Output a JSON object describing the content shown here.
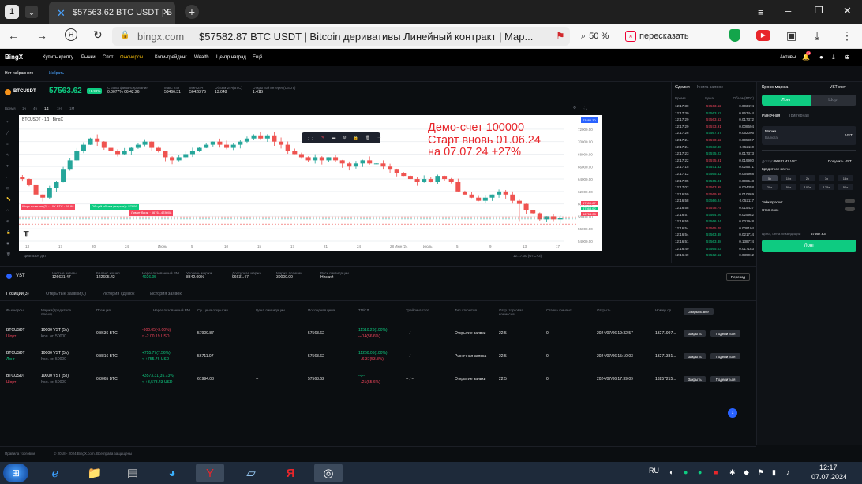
{
  "browser": {
    "tab_title": "$57563.62 BTC USDT | Б",
    "domain": "bingx.com",
    "page_title": "$57582.87 BTC USDT | Bitcoin деривативы Линейный контракт | Мар...",
    "zoom": "50 %",
    "retell": "пересказать"
  },
  "site": {
    "logo": "BingX",
    "nav": [
      "Купить крипту",
      "Рынки",
      "Спот",
      "Фьючерсы",
      "Копи-трейдинг",
      "Wealth",
      "Центр наград",
      "Ещё"
    ],
    "assets_label": "Активы",
    "notif_count": "24",
    "crumb_1": "Нет избранного",
    "crumb_2": "Избрать"
  },
  "ticker": {
    "symbol": "BTCUSDT",
    "leverage_badge": "+1.99%",
    "price": "57563.62",
    "stats": [
      {
        "label": "Ставка финансирования",
        "value": "0.0077% 06:42:26"
      },
      {
        "label": "Макс 24ч",
        "value": "58466.31"
      },
      {
        "label": "Мин 24ч",
        "value": "56428.76"
      },
      {
        "label": "Объем 24ч(BTC)",
        "value": "13.048"
      },
      {
        "label": "Открытый интерес(USDT)",
        "value": "1.41B"
      }
    ]
  },
  "chart": {
    "header": "BTCUSDT · 1Д · BingX",
    "annotation_lines": [
      "Демо-счет 100000",
      "Старт вновь 01.06.24",
      "на 07.07.24 +27%"
    ],
    "price_badges": [
      "57909.87",
      "57563.62",
      "56764.08"
    ],
    "top_badge": "73486.30",
    "y_ticks": [
      "72000.00",
      "70000.00",
      "68000.00",
      "66000.00",
      "64000.00",
      "62000.00",
      "60000.00",
      "58000.00",
      "56000.00",
      "54000.00"
    ],
    "x_ticks": [
      "13",
      "17",
      "20",
      "24",
      "Июнь",
      "5",
      "10",
      "15",
      "17",
      "21",
      "24",
      "28 Июн '24",
      "Июль",
      "5",
      "9",
      "13",
      "17"
    ],
    "position_label_1": "Шорт позиция (3) · 10K BTC · 59.98",
    "position_label_2": "Общий объем (маркет) · 57909",
    "position_label_3": "Лимит бирж · 56761.478008",
    "bottom_left": "Диапазон дат",
    "bottom_right": "12:17:30 (UTC+3)",
    "toolbar_intervals": [
      "Время",
      "1ч",
      "4ч",
      "1Д",
      "1Н",
      "1М"
    ]
  },
  "trades": {
    "tabs": [
      "Сделки",
      "Книга заявок"
    ],
    "headers": [
      "Время",
      "Цена",
      "Объем(BTC)"
    ],
    "rows": [
      {
        "t": "12:17:30",
        "p": "57563.62",
        "v": "0.003474",
        "c": "red"
      },
      {
        "t": "12:17:30",
        "p": "57563.62",
        "v": "0.867444",
        "c": "green"
      },
      {
        "t": "12:17:29",
        "p": "57563.62",
        "v": "0.017372",
        "c": "red"
      },
      {
        "t": "12:17:29",
        "p": "57573.91",
        "v": "0.008694",
        "c": "red"
      },
      {
        "t": "12:17:26",
        "p": "57567.87",
        "v": "0.052096",
        "c": "green"
      },
      {
        "t": "12:17:24",
        "p": "57570.62",
        "v": "0.005957",
        "c": "red"
      },
      {
        "t": "12:17:24",
        "p": "57572.88",
        "v": "0.052110",
        "c": "green"
      },
      {
        "t": "12:17:23",
        "p": "57575.23",
        "v": "0.017373",
        "c": "green"
      },
      {
        "t": "12:17:22",
        "p": "57575.91",
        "v": "0.019980",
        "c": "red"
      },
      {
        "t": "12:17:15",
        "p": "57571.52",
        "v": "0.025571",
        "c": "green"
      },
      {
        "t": "12:17:12",
        "p": "57565.62",
        "v": "0.064968",
        "c": "green"
      },
      {
        "t": "12:17:05",
        "p": "57565.01",
        "v": "0.008543",
        "c": "green"
      },
      {
        "t": "12:17:02",
        "p": "57563.98",
        "v": "0.004358",
        "c": "red"
      },
      {
        "t": "12:16:59",
        "p": "57569.99",
        "v": "0.010869",
        "c": "red"
      },
      {
        "t": "12:16:58",
        "p": "57566.24",
        "v": "0.052117",
        "c": "green"
      },
      {
        "t": "12:16:58",
        "p": "57578.74",
        "v": "0.015437",
        "c": "red"
      },
      {
        "t": "12:16:57",
        "p": "57564.26",
        "v": "0.025982",
        "c": "green"
      },
      {
        "t": "12:16:55",
        "p": "57566.24",
        "v": "0.001948",
        "c": "green"
      },
      {
        "t": "12:16:54",
        "p": "57565.09",
        "v": "0.008104",
        "c": "red"
      },
      {
        "t": "12:16:54",
        "p": "57563.88",
        "v": "0.021714",
        "c": "green"
      },
      {
        "t": "12:16:51",
        "p": "57563.88",
        "v": "0.138774",
        "c": "green"
      },
      {
        "t": "12:16:49",
        "p": "57565.03",
        "v": "0.017183",
        "c": "green"
      },
      {
        "t": "12:16:49",
        "p": "57562.62",
        "v": "0.039012",
        "c": "green"
      }
    ]
  },
  "order": {
    "mode": "Кросс-маржа",
    "account": "VST счет",
    "long_tab": "Лонг",
    "short_tab": "Шорт",
    "type_market": "Рыночная",
    "type_trigger": "Триггерная",
    "margin_label": "Маржа",
    "margin_placeholder": "Валюта",
    "margin_unit": "VST",
    "avail_label": "Доступ",
    "avail_value": "96631.47 VST",
    "get_label": "Получить VST",
    "lev_label": "Кредитное плечо",
    "lev_options": [
      "5x",
      "10x",
      "2x",
      "3x",
      "15x",
      "20x",
      "50x",
      "100x",
      "125x",
      "50x"
    ],
    "tp_label": "Тейк-профит",
    "sl_label": "Стоп-лосс",
    "liq_label": "Цена, цена ликвидации",
    "liq_value": "57567.83",
    "submit": "Лонг"
  },
  "account": {
    "currency": "VST",
    "stats": [
      {
        "label": "Чистые активы",
        "value": "126631.47"
      },
      {
        "label": "Баланс кошел.",
        "value": "122605.42"
      },
      {
        "label": "Нереализованный PNL",
        "value": "4026.05"
      },
      {
        "label": "Уровень маржи",
        "value": "8342.09%"
      },
      {
        "label": "Доступная маржа",
        "value": "96631.47"
      },
      {
        "label": "Маржа позиции",
        "value": "30000.00"
      },
      {
        "label": "Риск ликвидации",
        "value": "Низкий"
      }
    ],
    "transfer": "Перевод"
  },
  "position_tabs": [
    "Позиции(3)",
    "Открытые заявки(0)",
    "История сделок",
    "История заявок"
  ],
  "positions": {
    "headers": [
      "Фьючерсы",
      "Маржа(Кредитное плечо)",
      "Позиция",
      "Нереализованный PNL",
      "Ср. цена открытия",
      "Цена ликвидации",
      "Последняя цена",
      "ТП/СЛ",
      "Трейлинг-стоп",
      "Тип открытия",
      "Откр. торговая комиссия",
      "Ставка финанс.",
      "Открыть",
      "Номер ор.",
      "Закрыть все"
    ],
    "rows": [
      {
        "sym": "BTCUSDT",
        "side": "Шорт",
        "margin": "10000 VST (5x)",
        "margin2": "Кол. ог. 50000",
        "pos": "0.8636 BTC",
        "pnl1": "-300.05(-3.00%)",
        "pnl2": "≈ -2.00 19.USD",
        "avg": "57909.87",
        "liq": "--",
        "last": "57563.62",
        "tpsl1": "11510.28(100%)",
        "tpsl2": "--/14(56.6%)",
        "trail": "-- / --",
        "otype": "Открытие заявки",
        "fee": "22.5",
        "fund": "0",
        "time": "2024/07/06 19:32:57",
        "num": "13271997...",
        "pnlc": "red"
      },
      {
        "sym": "BTCUSDT",
        "side": "Лонг",
        "margin": "10000 VST (5x)",
        "margin2": "Кол. ог. 50000",
        "pos": "0.8816 BTC",
        "pnl1": "+755.77(7.56%)",
        "pnl2": "≈ +755.76 USD",
        "avg": "56711.07",
        "liq": "--",
        "last": "57563.62",
        "tpsl1": "11260.03(100%)",
        "tpsl2": "--/6.37(53.8%)",
        "trail": "-- / --",
        "otype": "Рыночная заявка",
        "fee": "22.5",
        "fund": "0",
        "time": "2024/07/06 15:10:03",
        "num": "13271331...",
        "pnlc": "green"
      },
      {
        "sym": "BTCUSDT",
        "side": "Шорт",
        "margin": "10000 VST (5x)",
        "margin2": "Кол. ог. 50000",
        "pos": "0.8065 BTC",
        "pnl1": "+3573.31(35.73%)",
        "pnl2": "≈ +3,573.43 USD",
        "avg": "61994.08",
        "liq": "--",
        "last": "57563.62",
        "tpsl1": "--/--",
        "tpsl2": "--/21(55.6%)",
        "trail": "-- / --",
        "otype": "Открытие заявки",
        "fee": "22.5",
        "fund": "0",
        "time": "2024/07/06 17:39:09",
        "num": "13257215...",
        "pnlc": "green"
      }
    ],
    "close_btn": "Закрыть",
    "share_btn": "Поделиться",
    "page": "1"
  },
  "footer": {
    "links": [
      "Правила торговли",
      "© 2018 - 2024 BingX.com. Все права защищены"
    ]
  },
  "taskbar": {
    "lang": "RU",
    "time": "12:17",
    "date": "07.07.2024"
  }
}
